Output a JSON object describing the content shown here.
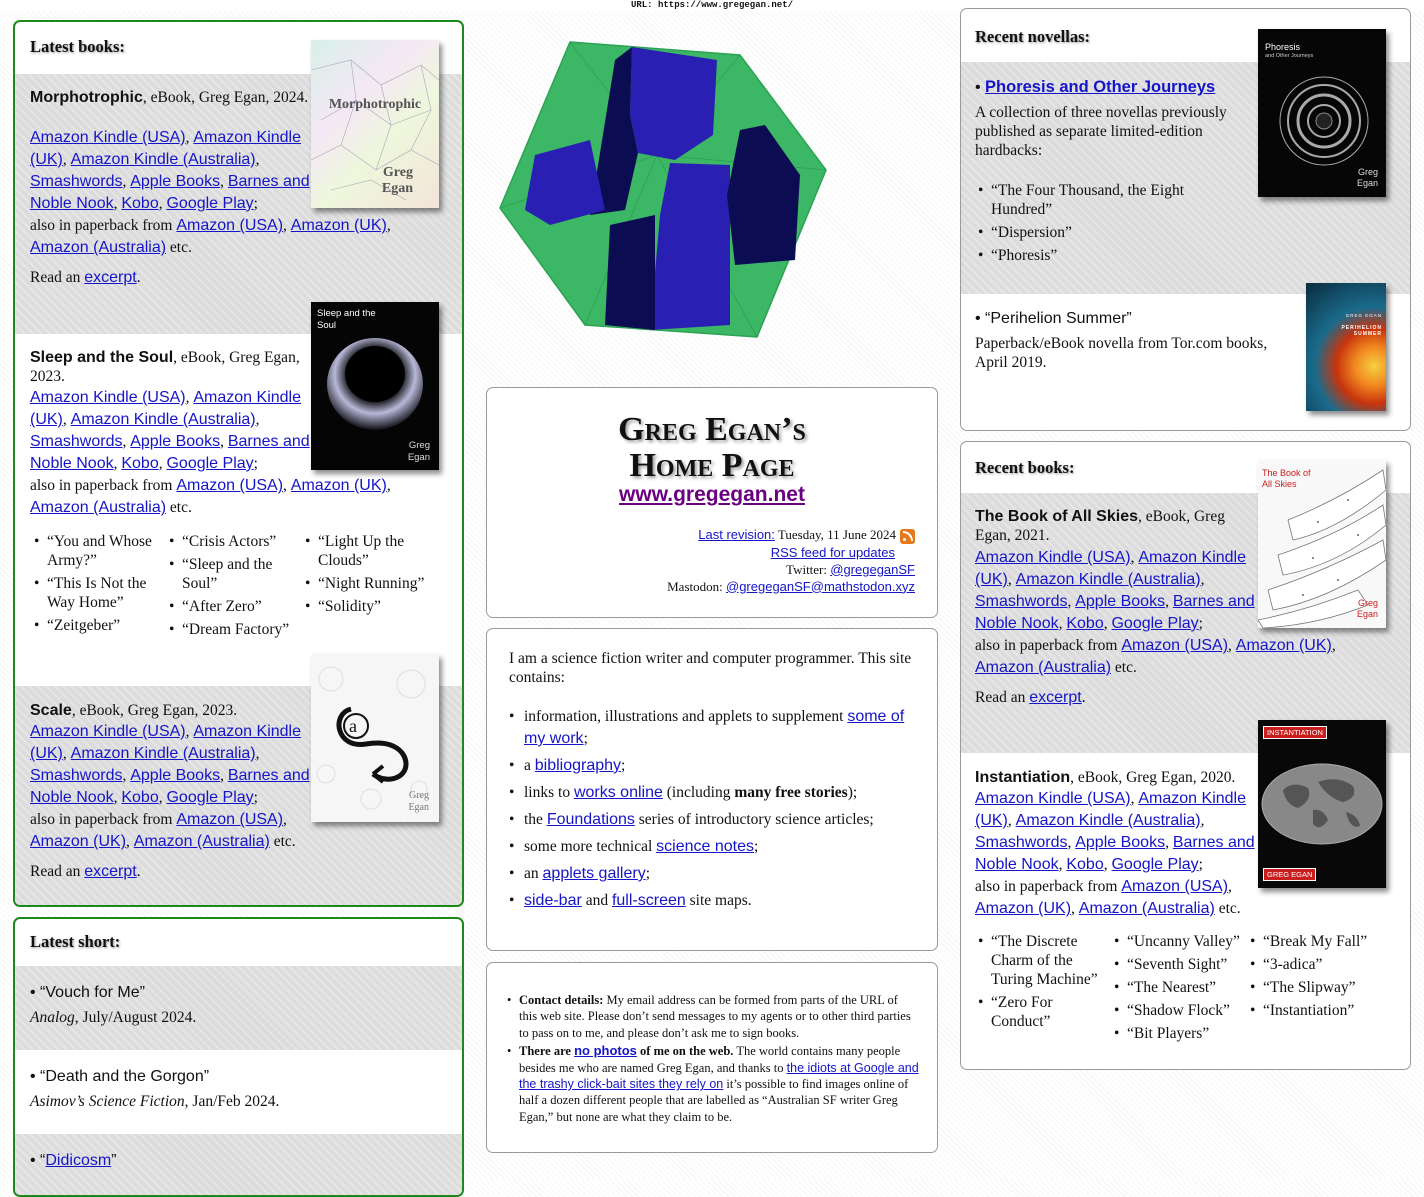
{
  "url_bar": "URL: https://www.gregegan.net/",
  "latest_books": {
    "heading": "Latest books:",
    "books": [
      {
        "title": "Morphotrophic",
        "meta": ", eBook, Greg Egan, 2024.",
        "cover_title": "Morphotrophic",
        "cover_author_1": "Greg",
        "cover_author_2": "Egan",
        "links": [
          "Amazon Kindle (USA)",
          "Amazon Kindle (UK)",
          "Amazon Kindle (Australia)",
          "Smashwords",
          "Apple Books",
          "Barnes and Noble Nook",
          "Kobo",
          "Google Play"
        ],
        "paperback_prefix": "also in paperback from",
        "paperback": [
          "Amazon (USA)",
          "Amazon (UK)",
          "Amazon (Australia)"
        ],
        "etc": "etc.",
        "read_prefix": "Read an",
        "excerpt": "excerpt"
      },
      {
        "title": "Sleep and the Soul",
        "meta": ", eBook, Greg Egan, 2023.",
        "cover_title": "Sleep and the Soul",
        "cover_author_1": "Greg",
        "cover_author_2": "Egan",
        "links": [
          "Amazon Kindle (USA)",
          "Amazon Kindle (UK)",
          "Amazon Kindle (Australia)",
          "Smashwords",
          "Apple Books",
          "Barnes and Noble Nook",
          "Kobo",
          "Google Play"
        ],
        "paperback_prefix": "also in paperback from",
        "paperback": [
          "Amazon (USA)",
          "Amazon (UK)",
          "Amazon (Australia)"
        ],
        "etc": "etc.",
        "stories_col1": [
          "“You and Whose Army?”",
          "“This Is Not the Way Home”",
          "“Zeitgeber”"
        ],
        "stories_col2": [
          "“Crisis Actors”",
          "“Sleep and the Soul”",
          "“After Zero”",
          "“Dream Factory”"
        ],
        "stories_col3": [
          "“Light Up the Clouds”",
          "“Night Running”",
          "“Solidity”"
        ]
      },
      {
        "title": "Scale",
        "meta": ", eBook, Greg Egan, 2023.",
        "cover_author_1": "Greg",
        "cover_author_2": "Egan",
        "links": [
          "Amazon Kindle (USA)",
          "Amazon Kindle (UK)",
          "Amazon Kindle (Australia)",
          "Smashwords",
          "Apple Books",
          "Barnes and Noble Nook",
          "Kobo",
          "Google Play"
        ],
        "paperback_prefix": "also in paperback from",
        "paperback": [
          "Amazon (USA)",
          "Amazon (UK)",
          "Amazon (Australia)"
        ],
        "etc": "etc.",
        "read_prefix": "Read an",
        "excerpt": "excerpt"
      }
    ]
  },
  "latest_short": {
    "heading": "Latest short:",
    "items": [
      {
        "title": "“Vouch for Me”",
        "venue": "Analog",
        "date": ", July/August 2024."
      },
      {
        "title": "“Death and the Gorgon”",
        "venue": "Asimov’s Science Fiction",
        "date": ", Jan/Feb 2024."
      },
      {
        "title_open": "“",
        "title_link": "Didicosm",
        "title_close": "”"
      }
    ]
  },
  "center": {
    "title_line1": "Greg Egan’s",
    "title_line2": "Home Page",
    "domain": "www.gregegan.net",
    "last_revision_label": "Last revision:",
    "last_revision_date": "Tuesday, 11 June 2024",
    "rss": "RSS feed for updates",
    "twitter_label": "Twitter:",
    "twitter": "@gregeganSF",
    "mastodon_label": "Mastodon:",
    "mastodon": "@gregeganSF@mathstodon.xyz",
    "intro": "I am a science fiction writer and computer programmer. This site contains:",
    "contents": {
      "c1_pre": "information, illustrations and applets to supplement",
      "c1_link": "some of my work",
      "c1_post": ";",
      "c2_pre": "a",
      "c2_link": "bibliography",
      "c2_post": ";",
      "c3_pre": "links to",
      "c3_link": "works online",
      "c3_mid": "(including",
      "c3_bold": "many free stories",
      "c3_post": ");",
      "c4_pre": "the",
      "c4_link": "Foundations",
      "c4_post": "series of introductory science articles;",
      "c5_pre": "some more technical",
      "c5_link": "science notes",
      "c5_post": ";",
      "c6_pre": "an",
      "c6_link": "applets gallery",
      "c6_post": ";",
      "c7_link1": "side-bar",
      "c7_mid": "and",
      "c7_link2": "full-screen",
      "c7_post": "site maps."
    },
    "notes": {
      "contact_bold": "Contact details:",
      "contact_text": "My email address can be formed from parts of the URL of this web site. Please don’t send messages to my agents or to other third parties to pass on to me, and please don’t ask me to sign books.",
      "photos_bold1": "There are",
      "photos_link": "no photos",
      "photos_bold2": "of me on the web.",
      "photos_text1": "The world contains many people besides me who are named Greg Egan, and thanks to",
      "photos_link2": "the idiots at Google and the trashy click-bait sites they rely on",
      "photos_text2": "it’s possible to find images online of half a dozen different people that are labelled as “Australian SF writer Greg Egan,” but none are what they claim to be."
    }
  },
  "recent_novellas": {
    "heading": "Recent novellas:",
    "item1_title": "Phoresis and Other Journeys",
    "item1_desc": "A collection of three novellas previously published as separate limited-edition hardbacks:",
    "item1_stories": [
      "“The Four Thousand, the Eight Hundred”",
      "“Dispersion”",
      "“Phoresis”"
    ],
    "item1_cover_title": "Phoresis",
    "item1_cover_sub": "and Other Journeys",
    "item1_cover_a1": "Greg",
    "item1_cover_a2": "Egan",
    "item2_title": "“Perihelion Summer”",
    "item2_desc": "Paperback/eBook novella from Tor.com books, April 2019.",
    "item2_cover_author": "GREG EGAN",
    "item2_cover_title": "PERIHELION SUMMER"
  },
  "recent_books": {
    "heading": "Recent books:",
    "books": [
      {
        "title": "The Book of All Skies",
        "meta": ", eBook, Greg Egan, 2021.",
        "cover_title": "The Book of All Skies",
        "cover_a1": "Greg",
        "cover_a2": "Egan",
        "links": [
          "Amazon Kindle (USA)",
          "Amazon Kindle (UK)",
          "Amazon Kindle (Australia)",
          "Smashwords",
          "Apple Books",
          "Barnes and Noble Nook",
          "Kobo",
          "Google Play"
        ],
        "paperback_prefix": "also in paperback from",
        "paperback": [
          "Amazon (USA)",
          "Amazon (UK)",
          "Amazon (Australia)"
        ],
        "etc": "etc.",
        "read_prefix": "Read an",
        "excerpt": "excerpt"
      },
      {
        "title": "Instantiation",
        "meta": ", eBook, Greg Egan, 2020.",
        "cover_title": "INSTANTIATION",
        "cover_author": "GREG EGAN",
        "links": [
          "Amazon Kindle (USA)",
          "Amazon Kindle (UK)",
          "Amazon Kindle (Australia)",
          "Smashwords",
          "Apple Books",
          "Barnes and Noble Nook",
          "Kobo",
          "Google Play"
        ],
        "paperback_prefix": "also in paperback from",
        "paperback": [
          "Amazon (USA)",
          "Amazon (UK)",
          "Amazon (Australia)"
        ],
        "etc": "etc.",
        "stories_col1": [
          "“The Discrete Charm of the Turing Machine”",
          "“Zero For Conduct”"
        ],
        "stories_col2": [
          "“Uncanny Valley”",
          "“Seventh Sight”",
          "“The Nearest”",
          "“Shadow Flock”",
          "“Bit Players”"
        ],
        "stories_col3": [
          "“Break My Fall”",
          "“3-adica”",
          "“The Slipway”",
          "“Instantiation”"
        ]
      }
    ]
  },
  "colors": {
    "panel_border_green": "#1b8a1b",
    "link": "#1515c8",
    "domain_link": "#6a0080",
    "stripe": "#dcdcdc",
    "logo_green": "#3cb765",
    "logo_blue": "#2a1fb3",
    "logo_navy": "#0c0c52"
  }
}
